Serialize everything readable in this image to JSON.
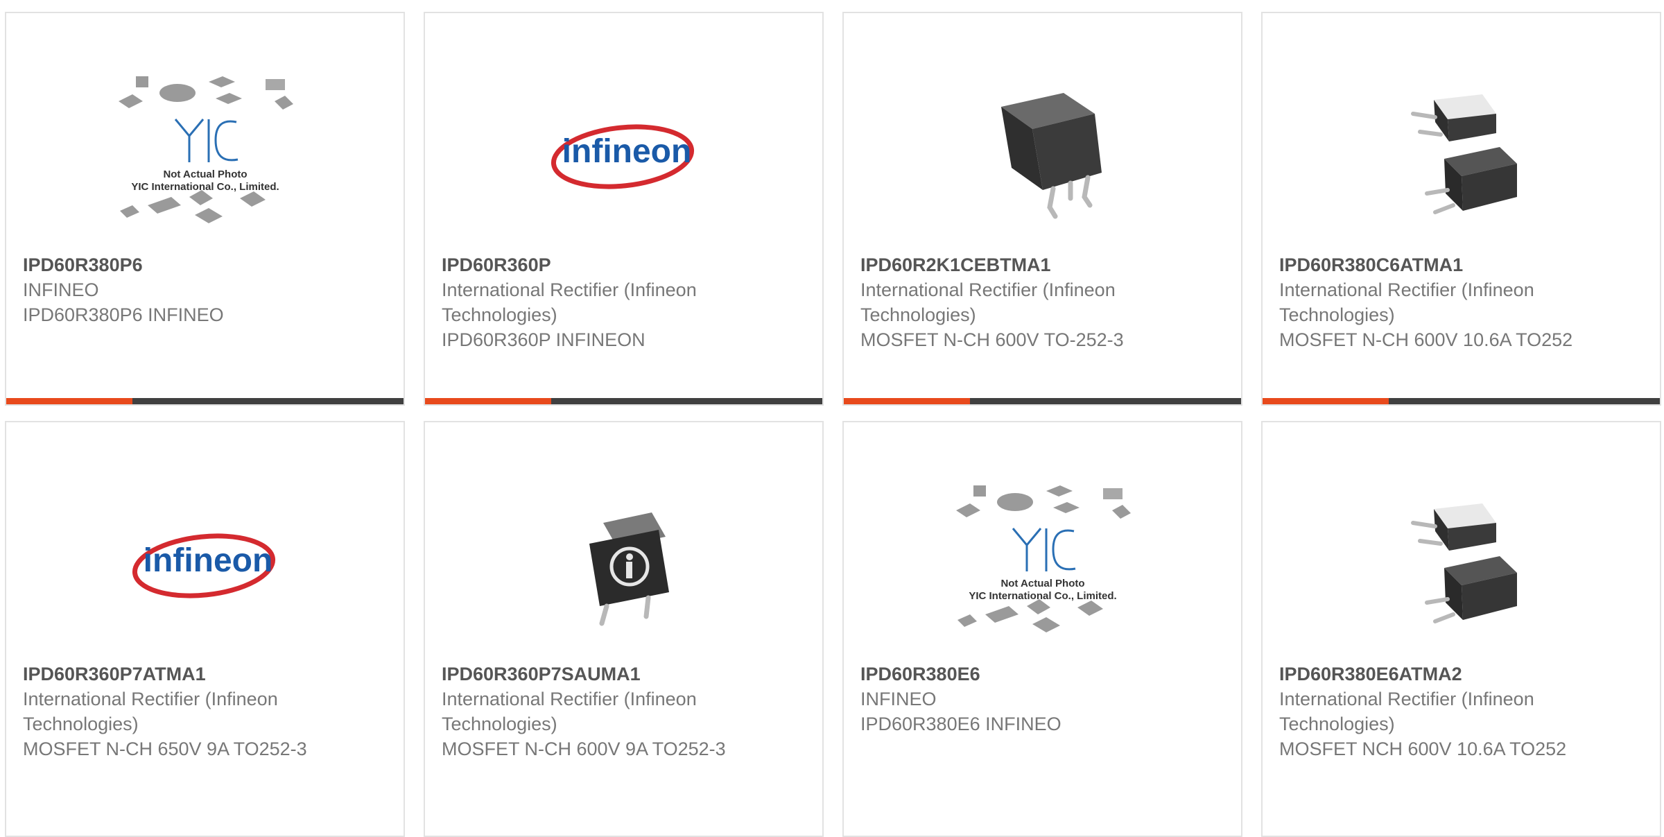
{
  "colors": {
    "accent": "#e84a1c",
    "bar_dark": "#404040",
    "title": "#555555",
    "text": "#777777",
    "border": "#e2e2e2"
  },
  "products": [
    {
      "part_number": "IPD60R380P6",
      "manufacturer": "INFINEO",
      "description": "IPD60R380P6 INFINEO",
      "image": "yic-placeholder-icon",
      "image_text_1": "Not Actual Photo",
      "image_text_2": "YIC International Co., Limited.",
      "image_logo": "YIC"
    },
    {
      "part_number": "IPD60R360P",
      "manufacturer": "International Rectifier (Infineon Technologies)",
      "description": "IPD60R360P INFINEON",
      "image": "infineon-logo-icon",
      "image_logo": "infineon"
    },
    {
      "part_number": "IPD60R2K1CEBTMA1",
      "manufacturer": "International Rectifier (Infineon Technologies)",
      "description": "MOSFET N-CH 600V TO-252-3",
      "image": "to252-package-icon"
    },
    {
      "part_number": "IPD60R380C6ATMA1",
      "manufacturer": "International Rectifier (Infineon Technologies)",
      "description": "MOSFET N-CH 600V 10.6A TO252",
      "image": "dpak-pair-icon"
    },
    {
      "part_number": "IPD60R360P7ATMA1",
      "manufacturer": "International Rectifier (Infineon Technologies)",
      "description": "MOSFET N-CH 650V 9A TO252-3",
      "image": "infineon-logo-icon",
      "image_logo": "infineon"
    },
    {
      "part_number": "IPD60R360P7SAUMA1",
      "manufacturer": "International Rectifier (Infineon Technologies)",
      "description": "MOSFET N-CH 600V 9A TO252-3",
      "image": "infineon-dpak-icon"
    },
    {
      "part_number": "IPD60R380E6",
      "manufacturer": "INFINEO",
      "description": "IPD60R380E6 INFINEO",
      "image": "yic-placeholder-icon",
      "image_text_1": "Not Actual Photo",
      "image_text_2": "YIC International Co., Limited.",
      "image_logo": "YIC"
    },
    {
      "part_number": "IPD60R380E6ATMA2",
      "manufacturer": "International Rectifier (Infineon Technologies)",
      "description": "MOSFET NCH 600V 10.6A TO252",
      "image": "dpak-pair-icon"
    }
  ]
}
